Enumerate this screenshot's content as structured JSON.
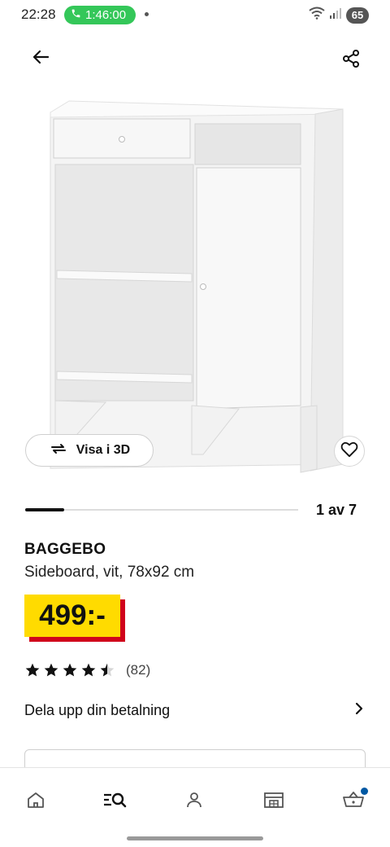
{
  "status_bar": {
    "time": "22:28",
    "call_timer": "1:46:00",
    "battery": "65"
  },
  "gallery": {
    "view_3d_label": "Visa i 3D",
    "page_indicator": "1 av 7",
    "progress_fraction": 0.143
  },
  "product": {
    "name": "BAGGEBO",
    "description": "Sideboard, vit, 78x92 cm",
    "price": "499:-",
    "rating_value": 4.5,
    "review_count": "(82)"
  },
  "installment": {
    "label": "Dela upp din betalning"
  },
  "colors": {
    "price_yellow": "#ffdb00",
    "price_red": "#d0021b",
    "call_green": "#34c759",
    "cart_badge": "#0058a3"
  },
  "icons": {
    "back": "arrow-left-icon",
    "share": "share-icon",
    "view_3d": "rotate-3d-icon",
    "favourite": "heart-icon",
    "installment_chevron": "chevron-right-icon",
    "nav": [
      "home-icon",
      "search-list-icon",
      "profile-icon",
      "store-icon",
      "cart-icon"
    ]
  }
}
